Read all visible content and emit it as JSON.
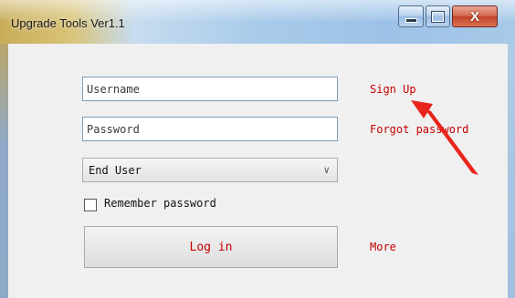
{
  "window": {
    "title": "Upgrade Tools Ver1.1",
    "controls": {
      "minimize_icon": "minimize-icon",
      "maximize_icon": "maximize-icon",
      "close_label": "X"
    }
  },
  "form": {
    "username": {
      "value": "",
      "placeholder": "Username"
    },
    "password": {
      "value": "",
      "placeholder": "Password"
    },
    "role_select": {
      "selected": "End User"
    },
    "remember": {
      "label": "Remember password",
      "checked": false
    },
    "login_label": "Log in"
  },
  "links": {
    "signup": "Sign Up",
    "forgot": "Forgot password",
    "more": "More"
  },
  "annotation": {
    "arrow_color": "#e8251c"
  },
  "colors": {
    "link": "#c40000",
    "close_button": "#c1432b"
  }
}
